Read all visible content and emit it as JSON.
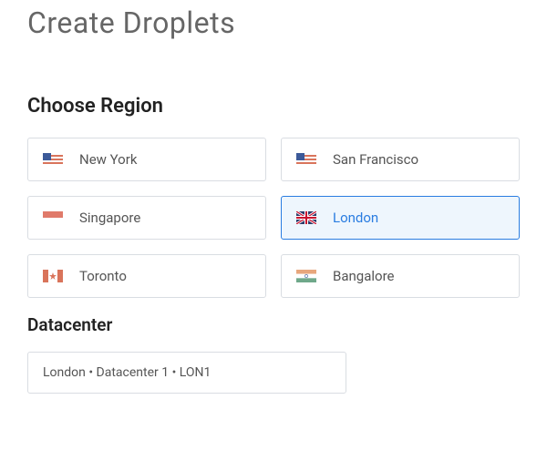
{
  "page": {
    "title": "Create Droplets"
  },
  "region_section": {
    "title": "Choose Region",
    "regions": [
      {
        "id": "new-york",
        "label": "New York",
        "flag": "us",
        "selected": false
      },
      {
        "id": "san-francisco",
        "label": "San Francisco",
        "flag": "us",
        "selected": false
      },
      {
        "id": "singapore",
        "label": "Singapore",
        "flag": "sg",
        "selected": false
      },
      {
        "id": "london",
        "label": "London",
        "flag": "gb",
        "selected": true
      },
      {
        "id": "toronto",
        "label": "Toronto",
        "flag": "ca",
        "selected": false
      },
      {
        "id": "bangalore",
        "label": "Bangalore",
        "flag": "in",
        "selected": false
      }
    ]
  },
  "datacenter_section": {
    "title": "Datacenter",
    "selected": "London • Datacenter 1 • LON1"
  },
  "flags": {
    "us": "US flag",
    "sg": "Singapore flag",
    "gb": "UK flag",
    "ca": "Canada flag",
    "in": "India flag"
  },
  "colors": {
    "accent": "#2a7de1",
    "border": "#d9dde2",
    "selected_bg": "#eef6fd"
  }
}
